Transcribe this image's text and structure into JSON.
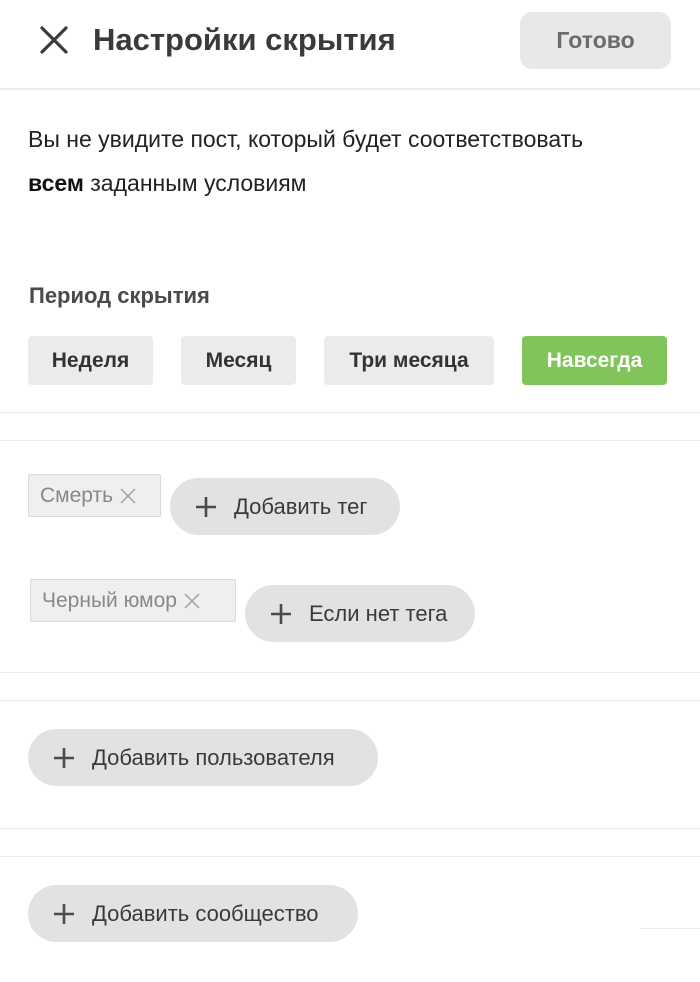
{
  "header": {
    "close_icon": "close-icon",
    "title": "Настройки скрытия",
    "done_label": "Готово"
  },
  "description": {
    "line1": "Вы не увидите пост, который будет соответствовать",
    "emphasis": "всем",
    "line2_rest": " заданным условиям"
  },
  "period": {
    "label": "Период скрытия",
    "options": [
      {
        "label": "Неделя",
        "active": false
      },
      {
        "label": "Месяц",
        "active": false
      },
      {
        "label": "Три месяца",
        "active": false
      },
      {
        "label": "Навсегда",
        "active": true
      }
    ]
  },
  "tags": {
    "include": [
      {
        "label": "Смерть"
      }
    ],
    "add_label": "Добавить тег",
    "exclude": [
      {
        "label": "Черный юмор"
      }
    ],
    "add_exclude_label": "Если нет тега"
  },
  "users": {
    "add_label": "Добавить пользователя"
  },
  "communities": {
    "add_label": "Добавить сообщество"
  },
  "colors": {
    "accent": "#80c45a",
    "pill_bg": "#ebebeb",
    "button_bg": "#e2e2e2",
    "tag_bg": "#efefef"
  },
  "icons": {
    "close": "close-icon",
    "remove_tag": "x-icon",
    "add": "plus-icon"
  }
}
